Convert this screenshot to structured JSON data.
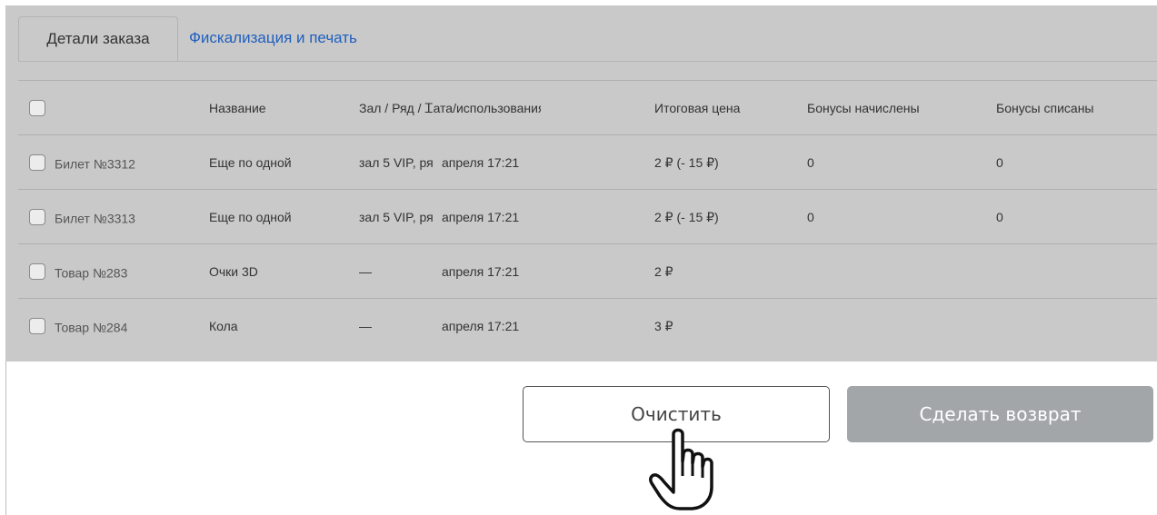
{
  "tabs": [
    {
      "label": "Детали заказа",
      "active": true
    },
    {
      "label": "Фискализация и печать",
      "active": false
    }
  ],
  "table": {
    "headers": {
      "name": "Название",
      "hall": "Зал / Ряд / Ꮖата/использования",
      "price": "Итоговая цена",
      "bonus_added": "Бонусы начислены",
      "bonus_spent": "Бонусы списаны"
    },
    "rows": [
      {
        "code": "Билет №3312",
        "name": "Еще по одной",
        "hall": "зал 5 VIP, ря",
        "date": "апреля 17:21",
        "price": "2 ₽ (- 15 ₽)",
        "bonus_added": "0",
        "bonus_spent": "0"
      },
      {
        "code": "Билет №3313",
        "name": "Еще по одной",
        "hall": "зал 5 VIP, ря",
        "date": "апреля 17:21",
        "price": "2 ₽ (- 15 ₽)",
        "bonus_added": "0",
        "bonus_spent": "0"
      },
      {
        "code": "Товар №283",
        "name": "Очки 3D",
        "hall": "—",
        "date": "апреля 17:21",
        "price": "2 ₽",
        "bonus_added": "",
        "bonus_spent": ""
      },
      {
        "code": "Товар №284",
        "name": "Кола",
        "hall": "—",
        "date": "апреля 17:21",
        "price": "3 ₽",
        "bonus_added": "",
        "bonus_spent": ""
      }
    ]
  },
  "buttons": {
    "clear": "Очистить",
    "refund": "Сделать возврат"
  },
  "colors": {
    "overlay": "#c9c9c9",
    "link": "#1f5fbf",
    "refund_button": "#a3a6a9"
  },
  "icons": {
    "cursor": "hand-pointer-icon"
  }
}
